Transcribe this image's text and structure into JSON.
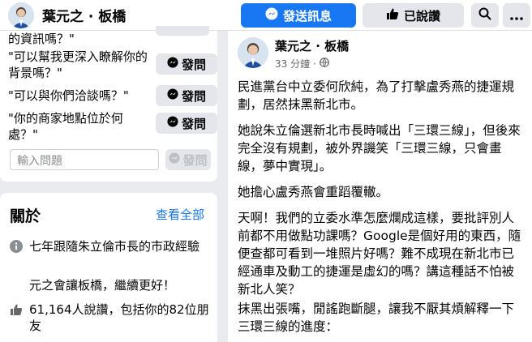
{
  "page": {
    "name": "葉元之 · 板橋"
  },
  "topbar": {
    "message_label": "發送訊息",
    "liked_label": "已說讚",
    "search_icon": "search-icon",
    "more_icon": "more-icon"
  },
  "questions": {
    "items": [
      {
        "text": "的資訊嗎？\""
      },
      {
        "text": "\"可以幫我更深入瞭解你的背景嗎？\"",
        "button": "發問"
      },
      {
        "text": "\"可以與你們洽談嗎？\"",
        "button": "發問"
      },
      {
        "text": "\"你的商家地點位於何處？\"",
        "button": "發問"
      }
    ],
    "input_placeholder": "輸入問題",
    "send_label": "發問"
  },
  "about": {
    "title": "關於",
    "see_all": "查看全部",
    "intro_line1": "七年跟隨朱立倫市長的市政經驗",
    "intro_line2": "元之會讓板橋，繼續更好！",
    "likes": "61,164人說讚，包括你的82位朋友"
  },
  "post": {
    "author": "葉元之 · 板橋",
    "time": "33 分鐘 ·",
    "paragraphs": [
      "民進黨台中立委何欣純，為了打擊盧秀燕的捷運規劃，居然抹黑新北市。",
      "她說朱立倫選新北市長時喊出「三環三線」，但後來完全沒有規劃，被外界譏笑「三環三線，只會畫線，夢中實現」。",
      "她擔心盧秀燕會重蹈覆轍。",
      "天啊！我們的立委水準怎麼爛成這樣，要批評別人前都不用做點功課嗎？Google是個好用的東西，隨便查都可看到一堆照片好嗎？難不成現在新北市已經通車及動工的捷運是虛幻的嗎？講這種話不怕被新北人笑？",
      "抹黑出張嘴，閒謠跑斷腿，讓我不厭其煩解釋一下三環三線的進度："
    ]
  },
  "colors": {
    "accent": "#1877f2",
    "background": "#e9ebee",
    "button_gray": "#e4e6eb"
  }
}
